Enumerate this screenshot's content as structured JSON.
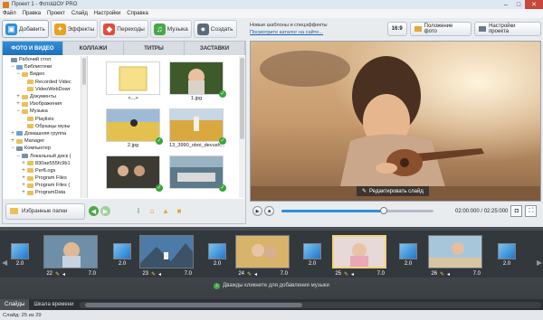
{
  "window": {
    "title": "Проект 1 - ФотоШОУ PRO"
  },
  "menu": [
    "Файл",
    "Правка",
    "Проект",
    "Слайд",
    "Настройки",
    "Справка"
  ],
  "tooltabs": [
    {
      "label": "Добавить",
      "icon": "add-photo-icon",
      "color": "#2f8fd9"
    },
    {
      "label": "Эффекты",
      "icon": "effects-icon",
      "color": "#e8a21f"
    },
    {
      "label": "Переходы",
      "icon": "transitions-icon",
      "color": "#e04d3c"
    },
    {
      "label": "Музыка",
      "icon": "music-icon",
      "color": "#48a84a"
    },
    {
      "label": "Создать",
      "icon": "create-icon",
      "color": "#5b6b7c"
    }
  ],
  "subtabs": [
    "ФОТО И ВИДЕО",
    "КОЛЛАЖИ",
    "ТИТРЫ",
    "ЗАСТАВКИ"
  ],
  "tree": [
    {
      "label": "Рабочий стол",
      "indent": 0,
      "exp": "",
      "kind": "pc"
    },
    {
      "label": "Библиотеки",
      "indent": 1,
      "exp": "−",
      "kind": "blue"
    },
    {
      "label": "Видео",
      "indent": 2,
      "exp": "−",
      "kind": "folder"
    },
    {
      "label": "Recorded Videc",
      "indent": 3,
      "exp": "",
      "kind": "folder"
    },
    {
      "label": "VideoWebDowr",
      "indent": 3,
      "exp": "",
      "kind": "folder"
    },
    {
      "label": "Документы",
      "indent": 2,
      "exp": "+",
      "kind": "folder"
    },
    {
      "label": "Изображения",
      "indent": 2,
      "exp": "+",
      "kind": "folder"
    },
    {
      "label": "Музыка",
      "indent": 2,
      "exp": "−",
      "kind": "folder"
    },
    {
      "label": "Playlists",
      "indent": 3,
      "exp": "",
      "kind": "folder"
    },
    {
      "label": "Образцы музы",
      "indent": 3,
      "exp": "",
      "kind": "folder"
    },
    {
      "label": "Домашняя группа",
      "indent": 1,
      "exp": "+",
      "kind": "blue"
    },
    {
      "label": "Manager",
      "indent": 1,
      "exp": "+",
      "kind": "folder"
    },
    {
      "label": "Компьютер",
      "indent": 1,
      "exp": "−",
      "kind": "pc"
    },
    {
      "label": "Локальный диск (",
      "indent": 2,
      "exp": "−",
      "kind": "pc"
    },
    {
      "label": "830ae555fc9b1",
      "indent": 3,
      "exp": "+",
      "kind": "folder"
    },
    {
      "label": "PerfLogs",
      "indent": 3,
      "exp": "+",
      "kind": "folder"
    },
    {
      "label": "Program Files",
      "indent": 3,
      "exp": "+",
      "kind": "folder"
    },
    {
      "label": "Program Files (",
      "indent": 3,
      "exp": "+",
      "kind": "folder"
    },
    {
      "label": "ProgramData",
      "indent": 3,
      "exp": "+",
      "kind": "folder"
    }
  ],
  "thumbs": [
    {
      "label": "<...>",
      "kind": "folder"
    },
    {
      "label": "1.jpg",
      "kind": "girl"
    },
    {
      "label": "2.jpg",
      "kind": "field"
    },
    {
      "label": "13_3990_oboi_devush...",
      "kind": "wheat"
    },
    {
      "label": "",
      "kind": "people"
    },
    {
      "label": "",
      "kind": "car"
    }
  ],
  "left_bottom": {
    "fav_label": "Избранные папки"
  },
  "right_top": {
    "templ_line1": "Новые шаблоны и спецэффекты",
    "templ_line2": "Посмотрите каталог на сайте...",
    "ratio": "16:9",
    "photo_pos": "Положение фото",
    "settings": "Настройки проекта"
  },
  "preview": {
    "edit_label": "Редактировать слайд"
  },
  "playback": {
    "time": "02:00:000 / 02:25:000",
    "progress": 0.67
  },
  "timeline": {
    "transitions": [
      {
        "dur": "2.0"
      },
      {
        "dur": "2.0"
      },
      {
        "dur": "2.0"
      },
      {
        "dur": "2.0"
      },
      {
        "dur": "2.0"
      },
      {
        "dur": "2.0"
      }
    ],
    "slides": [
      {
        "num": "22",
        "dur": "7.0",
        "kind": "girl2",
        "selected": false
      },
      {
        "num": "23",
        "dur": "7.0",
        "kind": "mountain",
        "selected": false
      },
      {
        "num": "24",
        "dur": "7.0",
        "kind": "girls",
        "selected": false
      },
      {
        "num": "25",
        "dur": "7.0",
        "kind": "pinkgirl",
        "selected": true
      },
      {
        "num": "26",
        "dur": "7.0",
        "kind": "beach",
        "selected": false
      }
    ],
    "music_hint": "Дважды кликните для добавления музыки"
  },
  "tltabs": [
    "Слайды",
    "Шкала времени"
  ],
  "status": "Слайд: 25 из 29"
}
